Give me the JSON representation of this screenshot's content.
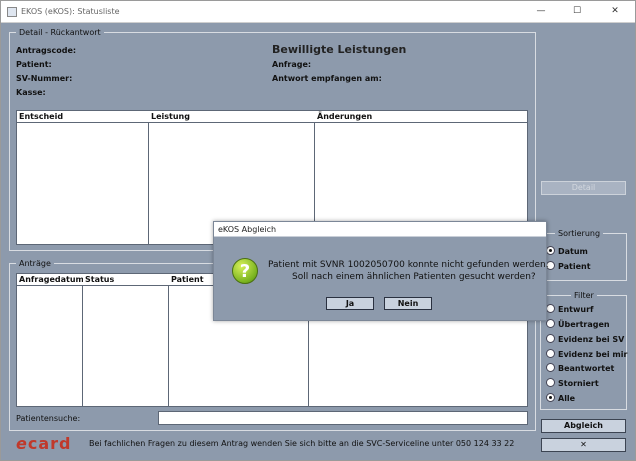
{
  "window": {
    "title": "EKOS (eKOS): Statusliste",
    "min": "—",
    "max": "☐",
    "close": "✕"
  },
  "detail": {
    "legend": "Detail - Rückantwort",
    "heading": "Bewilligte Leistungen",
    "antragscode": "Antragscode:",
    "patient": "Patient:",
    "sv_nummer": "SV-Nummer:",
    "kasse": "Kasse:",
    "anfrage": "Anfrage:",
    "antwort": "Antwort empfangen am:",
    "columns": [
      "Entscheid",
      "Leistung",
      "Änderungen"
    ]
  },
  "antraege": {
    "legend": "Anträge",
    "columns": [
      "Anfragedatum",
      "Status",
      "Patient"
    ]
  },
  "detail_button": "Detail",
  "sortierung": {
    "legend": "Sortierung",
    "options": [
      "Datum",
      "Patient"
    ],
    "selected": "Datum"
  },
  "filter": {
    "legend": "Filter",
    "options": [
      "Entwurf",
      "Übertragen",
      "Evidenz bei SV",
      "Evidenz bei mir",
      "Beantwortet",
      "Storniert",
      "Alle"
    ],
    "selected": "Alle"
  },
  "patientensuche": {
    "label": "Patientensuche:",
    "value": ""
  },
  "abgleich_button": "Abgleich",
  "close_button": "✕",
  "footer": {
    "logo_e": "e",
    "logo_card": "card",
    "text": "Bei fachlichen Fragen zu diesem Antrag wenden Sie sich bitte an die SVC-Serviceline unter 050 124 33 22"
  },
  "dialog": {
    "title": "eKOS Abgleich",
    "line1": "Patient      mit SVNR 1002050700 konnte nicht gefunden werden.",
    "line2": "Soll nach einem ähnlichen Patienten gesucht werden?",
    "yes": "Ja",
    "no": "Nein",
    "icon_glyph": "?"
  },
  "colors": {
    "panel": "#8d9aac",
    "logo_e": "#c0392b",
    "logo_card": "#c0392b"
  }
}
